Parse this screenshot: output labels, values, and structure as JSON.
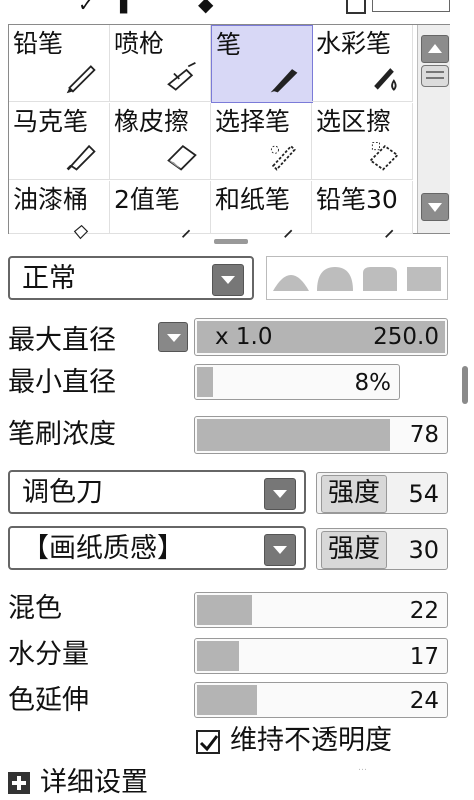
{
  "tools": [
    {
      "label": "铅笔",
      "icon": "pencil-icon",
      "selected": false
    },
    {
      "label": "喷枪",
      "icon": "airbrush-icon",
      "selected": false
    },
    {
      "label": "笔",
      "icon": "pen-icon",
      "selected": true
    },
    {
      "label": "水彩笔",
      "icon": "watercolor-brush-icon",
      "selected": false
    },
    {
      "label": "马克笔",
      "icon": "marker-icon",
      "selected": false
    },
    {
      "label": "橡皮擦",
      "icon": "eraser-icon",
      "selected": false
    },
    {
      "label": "选择笔",
      "icon": "selection-pen-icon",
      "selected": false
    },
    {
      "label": "选区擦",
      "icon": "selection-eraser-icon",
      "selected": false
    },
    {
      "label": "油漆桶",
      "icon": "bucket-icon",
      "selected": false
    },
    {
      "label": "2值笔",
      "icon": "binary-pen-icon",
      "selected": false
    },
    {
      "label": "和纸笔",
      "icon": "washi-pen-icon",
      "selected": false
    },
    {
      "label": "铅笔30",
      "icon": "pencil30-icon",
      "selected": false
    }
  ],
  "blend_mode": {
    "value": "正常"
  },
  "params": {
    "max_diameter": {
      "label": "最大直径",
      "multiplier": "x 1.0",
      "value": "250.0",
      "fill": 1.0
    },
    "min_diameter": {
      "label": "最小直径",
      "value": "8%",
      "fill": 0.08
    },
    "density": {
      "label": "笔刷浓度",
      "value": "78",
      "fill": 0.78
    },
    "blender": {
      "value": "调色刀",
      "strength_label": "强度",
      "strength_value": "54"
    },
    "texture": {
      "value": "【画纸质感】",
      "strength_label": "强度",
      "strength_value": "30"
    },
    "blending": {
      "label": "混色",
      "value": "22",
      "fill": 0.22
    },
    "dilution": {
      "label": "水分量",
      "value": "17",
      "fill": 0.17
    },
    "persistence": {
      "label": "色延伸",
      "value": "24",
      "fill": 0.24
    },
    "keep_opacity": {
      "label": "维持不透明度",
      "checked": true
    },
    "advanced": {
      "label": "详细设置"
    }
  },
  "colors": {
    "selected_cell": "#d8d8f6",
    "slider_fill": "#b4b4b4",
    "button_gray": "#888888"
  }
}
